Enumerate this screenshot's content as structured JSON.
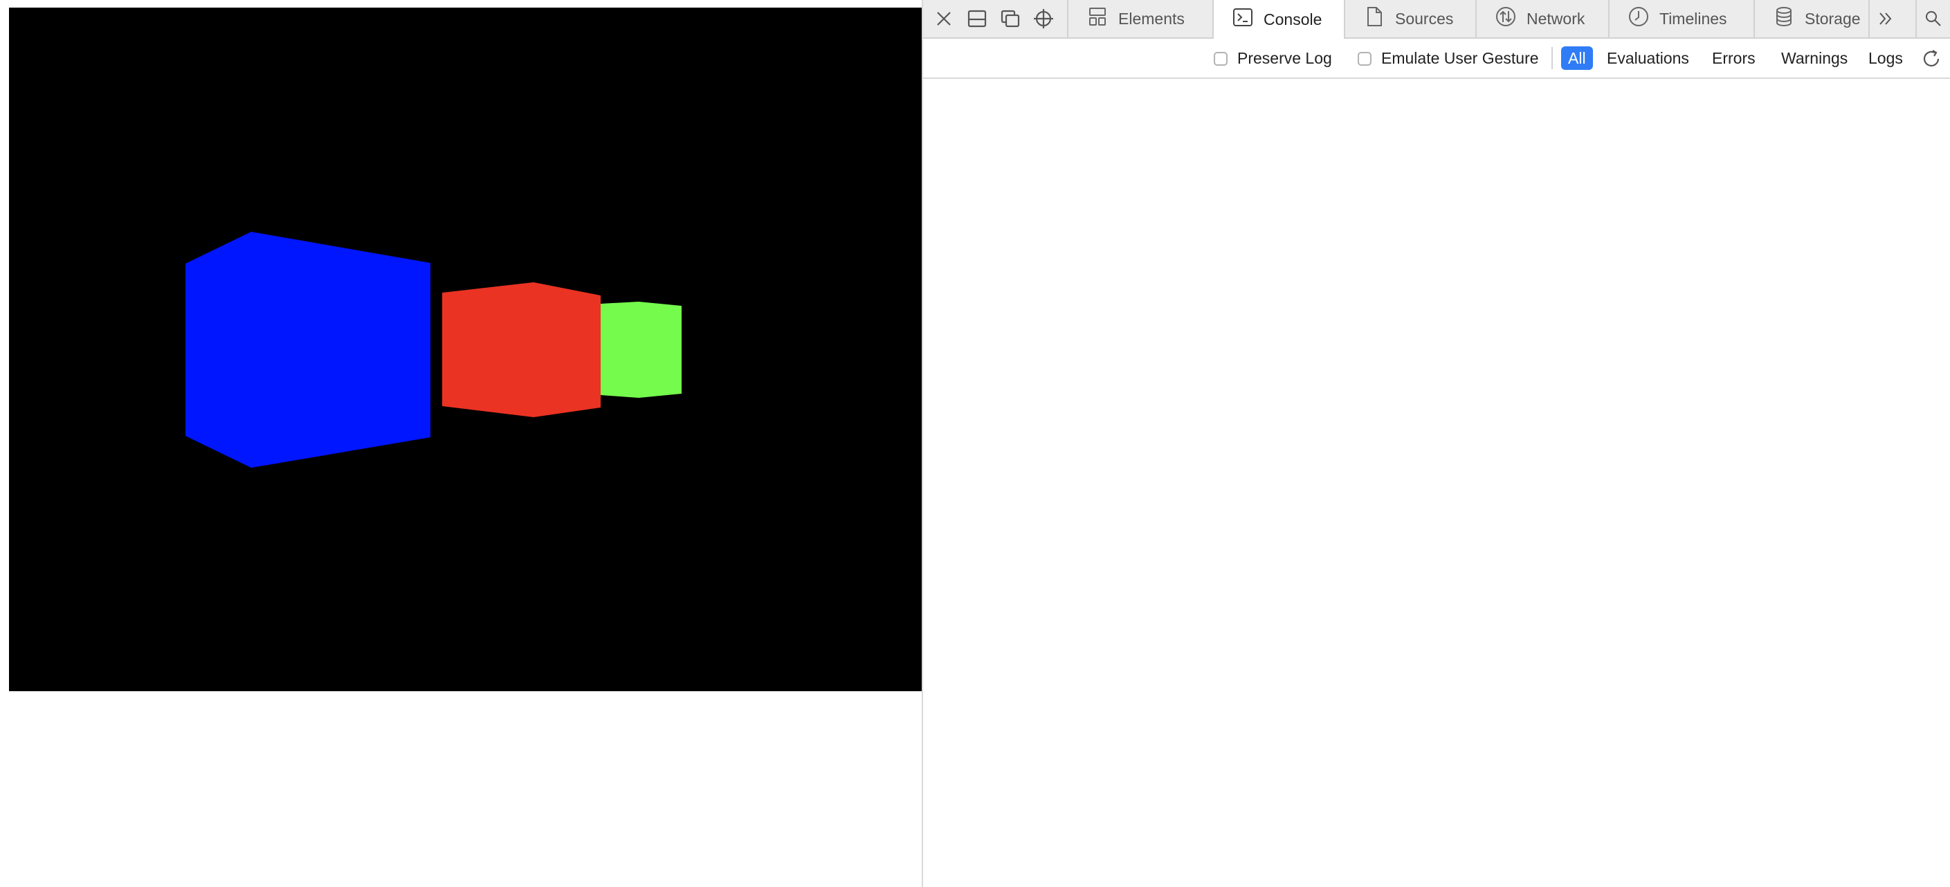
{
  "canvas": {
    "background": "#000000",
    "shapes": [
      {
        "name": "blue-cube",
        "color": "#0016ff"
      },
      {
        "name": "red-cube",
        "color": "#ea3323"
      },
      {
        "name": "green-cube",
        "color": "#75fb4c"
      }
    ]
  },
  "inspector": {
    "toolbar_icons": [
      "close-icon",
      "dock-bottom-icon",
      "undock-window-icon",
      "element-picker-icon"
    ],
    "tabs": [
      {
        "label": "Elements",
        "icon": "elements-icon"
      },
      {
        "label": "Console",
        "icon": "console-icon",
        "active": true
      },
      {
        "label": "Sources",
        "icon": "sources-icon"
      },
      {
        "label": "Network",
        "icon": "network-icon"
      },
      {
        "label": "Timelines",
        "icon": "timelines-icon"
      },
      {
        "label": "Storage",
        "icon": "storage-icon"
      }
    ],
    "overflow_icon": "chevron-double-right-icon",
    "search_icon": "search-icon"
  },
  "filter": {
    "preserve_log": "Preserve Log",
    "emulate_user_gesture": "Emulate User Gesture",
    "levels": [
      "All",
      "Evaluations",
      "Errors",
      "Warnings",
      "Logs"
    ],
    "active_level": "All",
    "accent_color": "#2f7cf6",
    "reload_icon": "reload-icon"
  }
}
